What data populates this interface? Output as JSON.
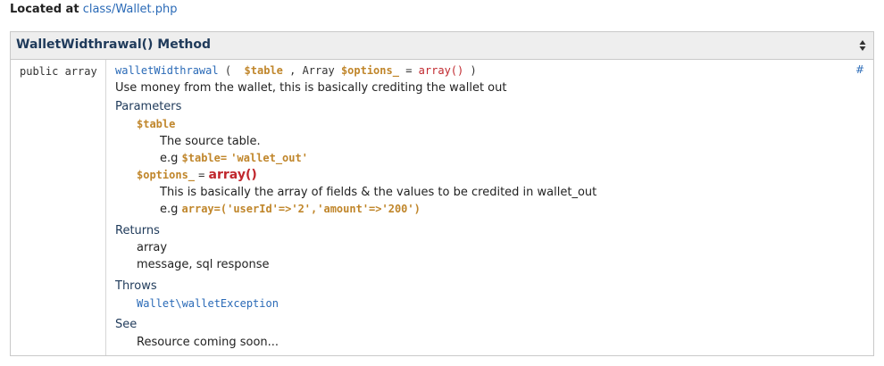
{
  "located": {
    "label": "Located at",
    "path": "class/Wallet.php"
  },
  "method": {
    "title": "WalletWidthrawal() Method",
    "return_type": "public array",
    "signature": {
      "name": "walletWidthrawal",
      "open_paren": "(",
      "param1": "$table",
      "comma": ",",
      "type2": "Array",
      "param2": "$options_",
      "equals": "=",
      "default2": "array()",
      "close_paren": ")"
    },
    "anchor": "#",
    "description": "Use money from the wallet, this is basically crediting the wallet out"
  },
  "parameters": {
    "heading": "Parameters",
    "items": [
      {
        "name": "$table",
        "desc": "The source table.",
        "eg_prefix": "e.g",
        "eg_code_var": "$table=",
        "eg_code_val": "'wallet_out'"
      },
      {
        "name": "$options_",
        "equals": "=",
        "default": "array()",
        "desc": "This is basically the array of fields & the values to be credited in wallet_out",
        "eg_prefix": "e.g",
        "eg_code": "array=('userId'=>'2','amount'=>'200')"
      }
    ]
  },
  "returns": {
    "heading": "Returns",
    "type": "array",
    "desc": "message, sql response"
  },
  "throws": {
    "heading": "Throws",
    "exception": "Wallet\\walletException"
  },
  "see": {
    "heading": "See",
    "text": "Resource coming soon..."
  },
  "icons": {
    "sort": "sort-toggle-icon"
  },
  "colors": {
    "link": "#2a6ab7",
    "variable": "#c0862b",
    "array": "#c0272d",
    "heading": "#1f3a5a"
  }
}
